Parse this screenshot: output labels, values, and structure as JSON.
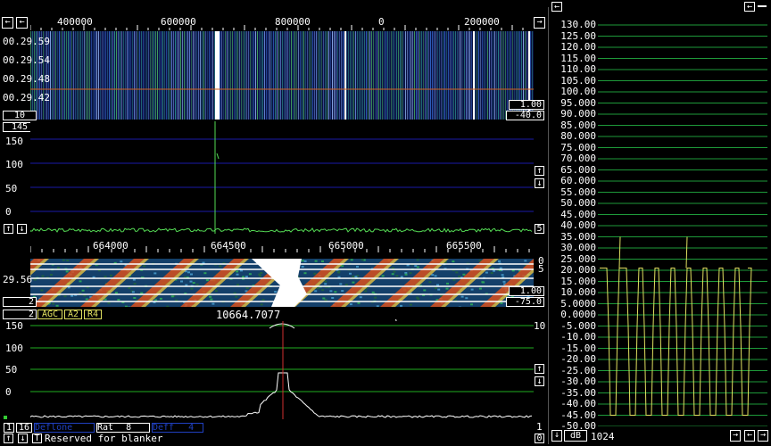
{
  "top_panel": {
    "freq_scale_labels": [
      "400000",
      "600000",
      "800000",
      "0",
      "200000"
    ],
    "waterfall_times": [
      "00.29.59",
      "00.29.54",
      "00.29.48",
      "00.29.42"
    ],
    "avg_box": "10",
    "gain_box": "1.00",
    "zero_box": "-40.0",
    "spectrum_top_box": "145",
    "spectrum_y_ticks": [
      "150",
      "100",
      "50",
      "0"
    ],
    "spectrum_right_box": "5"
  },
  "mid_panel": {
    "freq_scale_labels": [
      "664000",
      "664500",
      "665000",
      "665500"
    ],
    "waterfall_time": "29.56",
    "right_ticks": [
      "0",
      "5"
    ],
    "gain_box": "1.00",
    "zero_box": "-75.0",
    "left_box": "2"
  },
  "bottom_panel": {
    "left_box": "2",
    "buttons": [
      "AGC",
      "A2",
      "R4"
    ],
    "frequency_readout": "10664.7077",
    "y_ticks": [
      "150",
      "100",
      "50",
      "0"
    ],
    "right_top_box": "10",
    "right_bottom_box": "1",
    "bottom_right_box": "0"
  },
  "status_bar": {
    "box1": "1",
    "box2": "16",
    "field1": "Deflone",
    "rat_label": "Rat",
    "rat_value": "8",
    "field2": "Deff",
    "field2_value": "4",
    "letter": "T",
    "message": "Reserved for blanker"
  },
  "side_panel": {
    "y_labels": [
      "130.00",
      "125.00",
      "120.00",
      "115.00",
      "110.00",
      "105.00",
      "100.00",
      "95.000",
      "90.000",
      "85.000",
      "80.000",
      "75.000",
      "70.000",
      "65.000",
      "60.000",
      "55.000",
      "50.000",
      "45.000",
      "40.000",
      "35.000",
      "30.000",
      "25.000",
      "20.000",
      "15.000",
      "10.000",
      "5.0000",
      "0.0000",
      "-5.000",
      "-10.00",
      "-15.00",
      "-20.00",
      "-25.00",
      "-30.00",
      "-35.00",
      "-40.00",
      "-45.00",
      "-50.00"
    ],
    "unit_label": "dB",
    "count_label": "1024"
  },
  "colors": {
    "gridline_top": "#1a1aa8",
    "gridline_bottom": "#1fae1f",
    "gridline_side": "#1e9a3a",
    "spectrum_top": "#55dd55",
    "spectrum_bottom": "#ffffff",
    "signal_marker": "#d03030",
    "time_trace": "#e0e060"
  }
}
